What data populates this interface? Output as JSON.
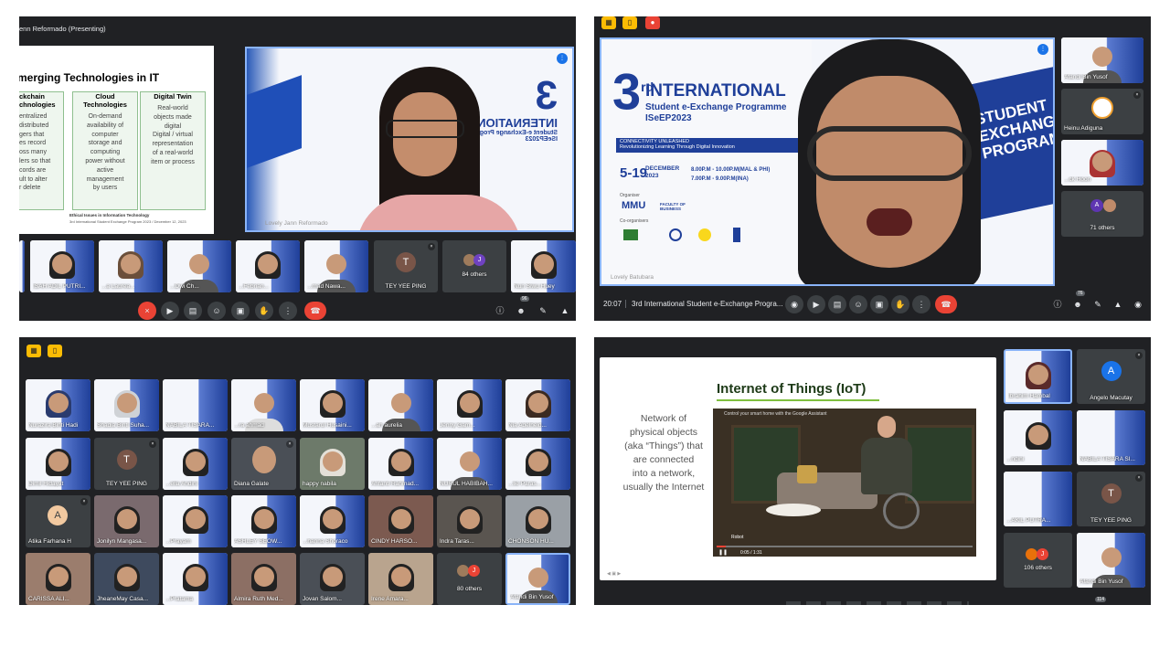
{
  "q1": {
    "presenting": "enn Reformado (Presenting)",
    "slide": {
      "title": "merging Technologies in IT",
      "cols": [
        {
          "head": "ckchain\nchnologies",
          "body": "entralized\ndistributed\ngers that\nes record\noss many\nlers so that\ncords are\nult to alter\nr delete"
        },
        {
          "head": "Cloud\nTechnologies",
          "body": "On-demand\navailability of\ncomputer\nstorage and\ncomputing\npower without\nactive\nmanagement\nby users"
        },
        {
          "head": "Digital Twin",
          "body": "Real-world\nobjects made\ndigital\nDigital / virtual\nrepresentation\nof a real-world\nitem or process"
        }
      ],
      "footer1": "Ethical Issues in Information Technology",
      "footer2": "3rd International Student Exchange Program 2023 / December 12, 2023"
    },
    "speaker_name": "Lovely Jann Reformado",
    "tiles": [
      "ISAH ADIL PUTRI...",
      "...a Laurea...",
      "...Dwi Ch...",
      "...Febrian...",
      "...mad Nawa...",
      "TEY YEE PING",
      "84 others",
      "Nun Siwu Huey"
    ],
    "tey_initial": "T",
    "others_initial": "J",
    "people_count": "96"
  },
  "q2": {
    "banner": {
      "ordinal": "3",
      "ordinal_sup": "rd",
      "line1": "INTERNATIONAL",
      "line2": "Student e-Exchange Programme",
      "line3": "ISeEP2023",
      "tag1": "CONNECTIVITY UNLEASHED",
      "tag2": "Revolutionizing Learning Through Digital Innovation",
      "dates": "5-19",
      "month": "DECEMBER\n2023",
      "time1": "8.00P.M - 10.00P.M(MAL & PHI)",
      "time2": "7.00P.M - 9.00P.M(INA)",
      "organiser": "Organiser",
      "org_logo": "MMU",
      "org_fac": "FACULTY OF\nBUSINESS",
      "coorg": "Co-organisers",
      "side": "STUDENT EXCHANGE PROGRAMME"
    },
    "speaker_name": "Lovely Batubara",
    "clock": "20:07",
    "meeting_title": "3rd International Student e-Exchange Progra...",
    "people_count": "76",
    "side_tiles": [
      "Afandi Bin Yusof",
      "Heinu Adiguna",
      "...ck Hoon",
      "71 others"
    ],
    "others_initial_a": "A"
  },
  "q3": {
    "rows": [
      [
        "Nurazira Binti Hadi",
        "Shadia Binti Suha...",
        "NABILA TISARA...",
        "...ra ahmad",
        "Mustarul Husaini...",
        "...ah aurelia",
        "Jenny Gam...",
        "Nia Adelheid..."
      ],
      [
        "Dimil Hidayat",
        "TEY YEE PING",
        "...ella Andini",
        "Diana Galate",
        "happy nabila",
        "Arifanti Rahmad...",
        "NURUL HABIBAH...",
        "...lie Paras..."
      ],
      [
        "Atika Farhana H",
        "Jonilyn Mangasa...",
        "...Prayam",
        "ASHLEY SEOW...",
        "...hanna Shoraco",
        "CINDY HARSO...",
        "Indra Taras...",
        "CHONSON HU..."
      ],
      [
        "CARISSA ALI...",
        "JheaneMay Casa...",
        "...Pratama",
        "Almira Ruth Med...",
        "Jovan Salom...",
        "Irene Amara...",
        "80 others",
        "Afandi Bin Yusof"
      ]
    ],
    "tey_initial": "T",
    "atika_initial": "A",
    "others_initial": "J"
  },
  "q4": {
    "slide_title": "Internet of Things (IoT)",
    "slide_text": "Network of\nphysical objects\n(aka “Things”) that\nare connected\ninto a network,\nusually the Internet",
    "video_title": "Control your smart home with the Google Assistant",
    "video_caption": "Robot",
    "video_time": "0:05 / 1:31",
    "side_tiles": [
      "Ibrahim Hambal",
      "Angelo Macutay",
      "...ndini",
      "NABILA TISARA SI...",
      "...AKIL PUTRA...",
      "TEY YEE PING",
      "106 others",
      "Afandi Bin Yusof"
    ],
    "angelo_initial": "A",
    "tey_initial": "T",
    "others_initial": "J",
    "people_count": "114"
  },
  "colors": {
    "meet_bg": "#202124",
    "tile_bg": "#3c4043",
    "end_red": "#ea4335",
    "present_blue": "#8ab4f8"
  }
}
